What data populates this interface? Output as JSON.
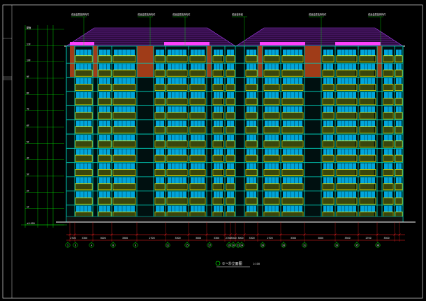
{
  "drawing": {
    "title": "①~㉝立面图",
    "scale": "1:100",
    "axis_labels": [
      "1",
      "3",
      "4",
      "6",
      "9",
      "11",
      "15",
      "17",
      "19",
      "20",
      "21",
      "24",
      "26",
      "28",
      "31",
      "33",
      "35",
      "36"
    ],
    "callouts": [
      "成品金属装饰构件",
      "成品金属装饰构件",
      "成品金属装饰构件",
      "成品装饰线",
      "成品金属装饰构件",
      "成品金属装饰构件"
    ],
    "level_labels": [
      "屋面",
      "11F",
      "10F",
      "9F",
      "8F",
      "7F",
      "6F",
      "5F",
      "4F",
      "3F",
      "2F",
      "1F",
      "±0.000"
    ],
    "dimension_labels": [
      "2700",
      "3300",
      "3000",
      "3300",
      "2700",
      "3300",
      "3000",
      "3300",
      "2700",
      "3300",
      "3000",
      "3300",
      "2700",
      "3300",
      "3000",
      "3300",
      "2700",
      "3300"
    ]
  },
  "colors": {
    "background": "#000000",
    "wall": "#00c8b4",
    "window": "#ffff00",
    "glass": "#00c0ff",
    "roof": "#b040ff",
    "roof_band": "#ff40ff",
    "brick": "#a03c18",
    "axis": "#00ff00",
    "dimension": "#ff2020"
  }
}
